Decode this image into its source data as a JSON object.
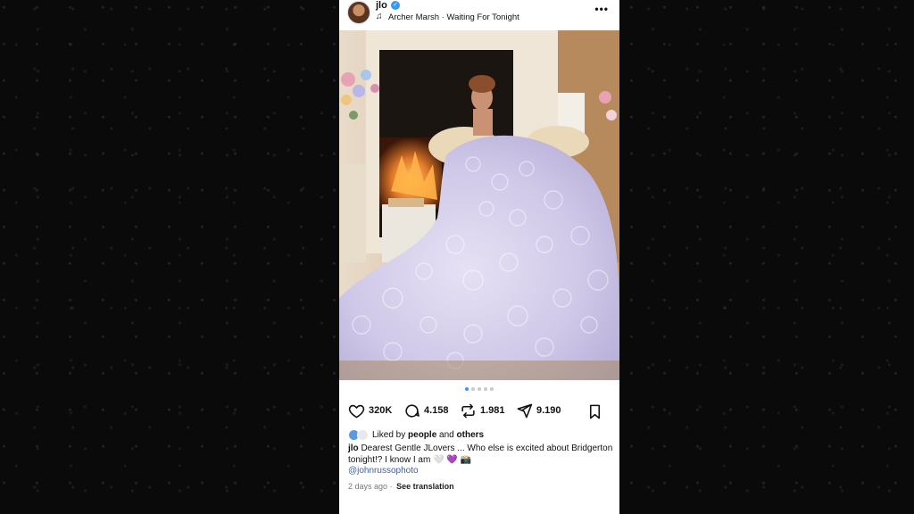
{
  "post": {
    "username": "jlo",
    "audio": {
      "artist": "Archer Marsh",
      "separator": "·",
      "track": "Waiting For Tonight"
    },
    "more_icon": "more-horizontal-icon",
    "carousel": {
      "count": 5,
      "active": 0
    },
    "stats": {
      "likes": "320K",
      "comments": "4.158",
      "reposts": "1.981",
      "shares": "9.190"
    },
    "liked_by": {
      "prefix": "Liked by",
      "people": "people",
      "and": "and",
      "others": "others"
    },
    "caption": {
      "user": "jlo",
      "text": "Dearest Gentle JLovers ... Who else is excited about Bridgerton tonight!? I know I am 🤍 💜 📸",
      "mention": "@johnrussophoto"
    },
    "footer": {
      "time": "2 days ago",
      "separator": "·",
      "see_translation": "See translation"
    },
    "colors": {
      "accent": "#3897f0",
      "link": "#3b5fae",
      "gown": "#cfc8e8"
    }
  }
}
